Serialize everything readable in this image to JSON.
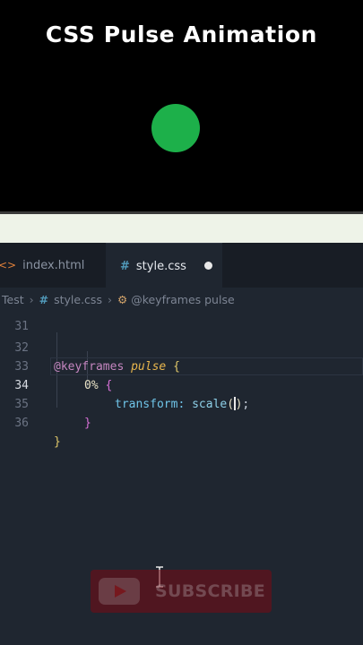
{
  "video": {
    "title": "CSS Pulse Animation",
    "ball_color": "#1db04a"
  },
  "tabs": [
    {
      "label": "index.html",
      "icon": "html-icon",
      "active": false
    },
    {
      "label": "style.css",
      "icon": "css-hash-icon",
      "active": true,
      "modified": true
    }
  ],
  "breadcrumb": {
    "folder": "Test",
    "file": "style.css",
    "symbol": "@keyframes pulse"
  },
  "code": {
    "partial_line_number": "31",
    "lines": [
      {
        "num": "32",
        "kw": "@keyframes",
        "name": "pulse",
        "brace": "{"
      },
      {
        "num": "33",
        "pct": "0%",
        "brace": "{"
      },
      {
        "num": "34",
        "prop": "transform:",
        "fn": "scale",
        "open": "(",
        "close": ")",
        "semi": ";"
      },
      {
        "num": "35",
        "brace": "}"
      },
      {
        "num": "36",
        "brace": "}"
      }
    ]
  },
  "overlay": {
    "subscribe_label": "SUBSCRIBE"
  }
}
